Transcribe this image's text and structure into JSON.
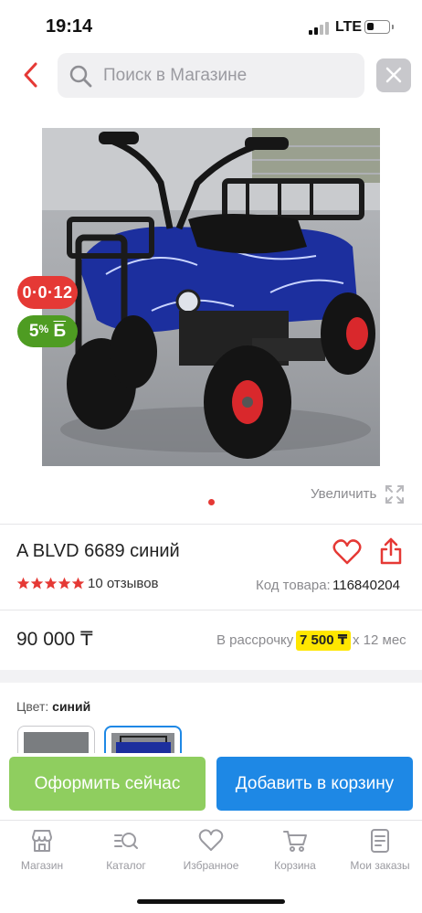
{
  "status_bar": {
    "time": "19:14",
    "network": "LTE",
    "battery_level": 0.3
  },
  "search": {
    "placeholder": "Поиск в Магазине"
  },
  "product": {
    "image_subject": "blue kids ATV quad bike",
    "badge_timer": "0·0·12",
    "badge_bonus_pct": "5",
    "badge_bonus_unit": "%",
    "badge_bonus_letter": "Б",
    "zoom_label": "Увеличить",
    "image_count": 1,
    "active_image": 1,
    "title": "A BLVD 6689 синий",
    "rating": 5,
    "reviews": "10 отзывов",
    "code_label": "Код товара:",
    "code_value": "116840204",
    "price": "90 000 ₸",
    "installment_label": "В рассрочку",
    "installment_amount": "7 500 ₸",
    "installment_term": "х 12 мес",
    "color_label": "Цвет:",
    "color_value": "синий",
    "color_swatches": [
      {
        "name": "swatch-1",
        "selected": false
      },
      {
        "name": "swatch-2",
        "selected": true
      }
    ]
  },
  "actions": {
    "checkout": "Оформить сейчас",
    "add_to_cart": "Добавить в корзину"
  },
  "tabbar": {
    "items": [
      {
        "label": "Магазин",
        "icon": "store-icon"
      },
      {
        "label": "Каталог",
        "icon": "catalog-icon"
      },
      {
        "label": "Избранное",
        "icon": "heart-icon"
      },
      {
        "label": "Корзина",
        "icon": "cart-icon"
      },
      {
        "label": "Мои заказы",
        "icon": "orders-icon"
      }
    ]
  },
  "colors": {
    "accent_red": "#e53935",
    "bonus_green": "#4e9c22",
    "checkout_green": "#8fce5f",
    "cart_blue": "#1e88e5",
    "installment_yellow": "#ffe600"
  }
}
